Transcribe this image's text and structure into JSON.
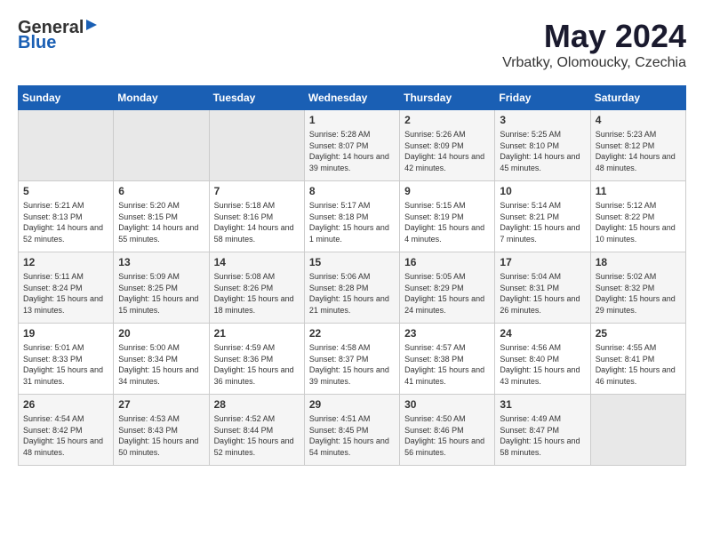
{
  "header": {
    "logo_general": "General",
    "logo_blue": "Blue",
    "month_year": "May 2024",
    "location": "Vrbatky, Olomoucky, Czechia"
  },
  "days_of_week": [
    "Sunday",
    "Monday",
    "Tuesday",
    "Wednesday",
    "Thursday",
    "Friday",
    "Saturday"
  ],
  "weeks": [
    [
      {
        "day": "",
        "info": ""
      },
      {
        "day": "",
        "info": ""
      },
      {
        "day": "",
        "info": ""
      },
      {
        "day": "1",
        "info": "Sunrise: 5:28 AM\nSunset: 8:07 PM\nDaylight: 14 hours and 39 minutes."
      },
      {
        "day": "2",
        "info": "Sunrise: 5:26 AM\nSunset: 8:09 PM\nDaylight: 14 hours and 42 minutes."
      },
      {
        "day": "3",
        "info": "Sunrise: 5:25 AM\nSunset: 8:10 PM\nDaylight: 14 hours and 45 minutes."
      },
      {
        "day": "4",
        "info": "Sunrise: 5:23 AM\nSunset: 8:12 PM\nDaylight: 14 hours and 48 minutes."
      }
    ],
    [
      {
        "day": "5",
        "info": "Sunrise: 5:21 AM\nSunset: 8:13 PM\nDaylight: 14 hours and 52 minutes."
      },
      {
        "day": "6",
        "info": "Sunrise: 5:20 AM\nSunset: 8:15 PM\nDaylight: 14 hours and 55 minutes."
      },
      {
        "day": "7",
        "info": "Sunrise: 5:18 AM\nSunset: 8:16 PM\nDaylight: 14 hours and 58 minutes."
      },
      {
        "day": "8",
        "info": "Sunrise: 5:17 AM\nSunset: 8:18 PM\nDaylight: 15 hours and 1 minute."
      },
      {
        "day": "9",
        "info": "Sunrise: 5:15 AM\nSunset: 8:19 PM\nDaylight: 15 hours and 4 minutes."
      },
      {
        "day": "10",
        "info": "Sunrise: 5:14 AM\nSunset: 8:21 PM\nDaylight: 15 hours and 7 minutes."
      },
      {
        "day": "11",
        "info": "Sunrise: 5:12 AM\nSunset: 8:22 PM\nDaylight: 15 hours and 10 minutes."
      }
    ],
    [
      {
        "day": "12",
        "info": "Sunrise: 5:11 AM\nSunset: 8:24 PM\nDaylight: 15 hours and 13 minutes."
      },
      {
        "day": "13",
        "info": "Sunrise: 5:09 AM\nSunset: 8:25 PM\nDaylight: 15 hours and 15 minutes."
      },
      {
        "day": "14",
        "info": "Sunrise: 5:08 AM\nSunset: 8:26 PM\nDaylight: 15 hours and 18 minutes."
      },
      {
        "day": "15",
        "info": "Sunrise: 5:06 AM\nSunset: 8:28 PM\nDaylight: 15 hours and 21 minutes."
      },
      {
        "day": "16",
        "info": "Sunrise: 5:05 AM\nSunset: 8:29 PM\nDaylight: 15 hours and 24 minutes."
      },
      {
        "day": "17",
        "info": "Sunrise: 5:04 AM\nSunset: 8:31 PM\nDaylight: 15 hours and 26 minutes."
      },
      {
        "day": "18",
        "info": "Sunrise: 5:02 AM\nSunset: 8:32 PM\nDaylight: 15 hours and 29 minutes."
      }
    ],
    [
      {
        "day": "19",
        "info": "Sunrise: 5:01 AM\nSunset: 8:33 PM\nDaylight: 15 hours and 31 minutes."
      },
      {
        "day": "20",
        "info": "Sunrise: 5:00 AM\nSunset: 8:34 PM\nDaylight: 15 hours and 34 minutes."
      },
      {
        "day": "21",
        "info": "Sunrise: 4:59 AM\nSunset: 8:36 PM\nDaylight: 15 hours and 36 minutes."
      },
      {
        "day": "22",
        "info": "Sunrise: 4:58 AM\nSunset: 8:37 PM\nDaylight: 15 hours and 39 minutes."
      },
      {
        "day": "23",
        "info": "Sunrise: 4:57 AM\nSunset: 8:38 PM\nDaylight: 15 hours and 41 minutes."
      },
      {
        "day": "24",
        "info": "Sunrise: 4:56 AM\nSunset: 8:40 PM\nDaylight: 15 hours and 43 minutes."
      },
      {
        "day": "25",
        "info": "Sunrise: 4:55 AM\nSunset: 8:41 PM\nDaylight: 15 hours and 46 minutes."
      }
    ],
    [
      {
        "day": "26",
        "info": "Sunrise: 4:54 AM\nSunset: 8:42 PM\nDaylight: 15 hours and 48 minutes."
      },
      {
        "day": "27",
        "info": "Sunrise: 4:53 AM\nSunset: 8:43 PM\nDaylight: 15 hours and 50 minutes."
      },
      {
        "day": "28",
        "info": "Sunrise: 4:52 AM\nSunset: 8:44 PM\nDaylight: 15 hours and 52 minutes."
      },
      {
        "day": "29",
        "info": "Sunrise: 4:51 AM\nSunset: 8:45 PM\nDaylight: 15 hours and 54 minutes."
      },
      {
        "day": "30",
        "info": "Sunrise: 4:50 AM\nSunset: 8:46 PM\nDaylight: 15 hours and 56 minutes."
      },
      {
        "day": "31",
        "info": "Sunrise: 4:49 AM\nSunset: 8:47 PM\nDaylight: 15 hours and 58 minutes."
      },
      {
        "day": "",
        "info": ""
      }
    ]
  ]
}
